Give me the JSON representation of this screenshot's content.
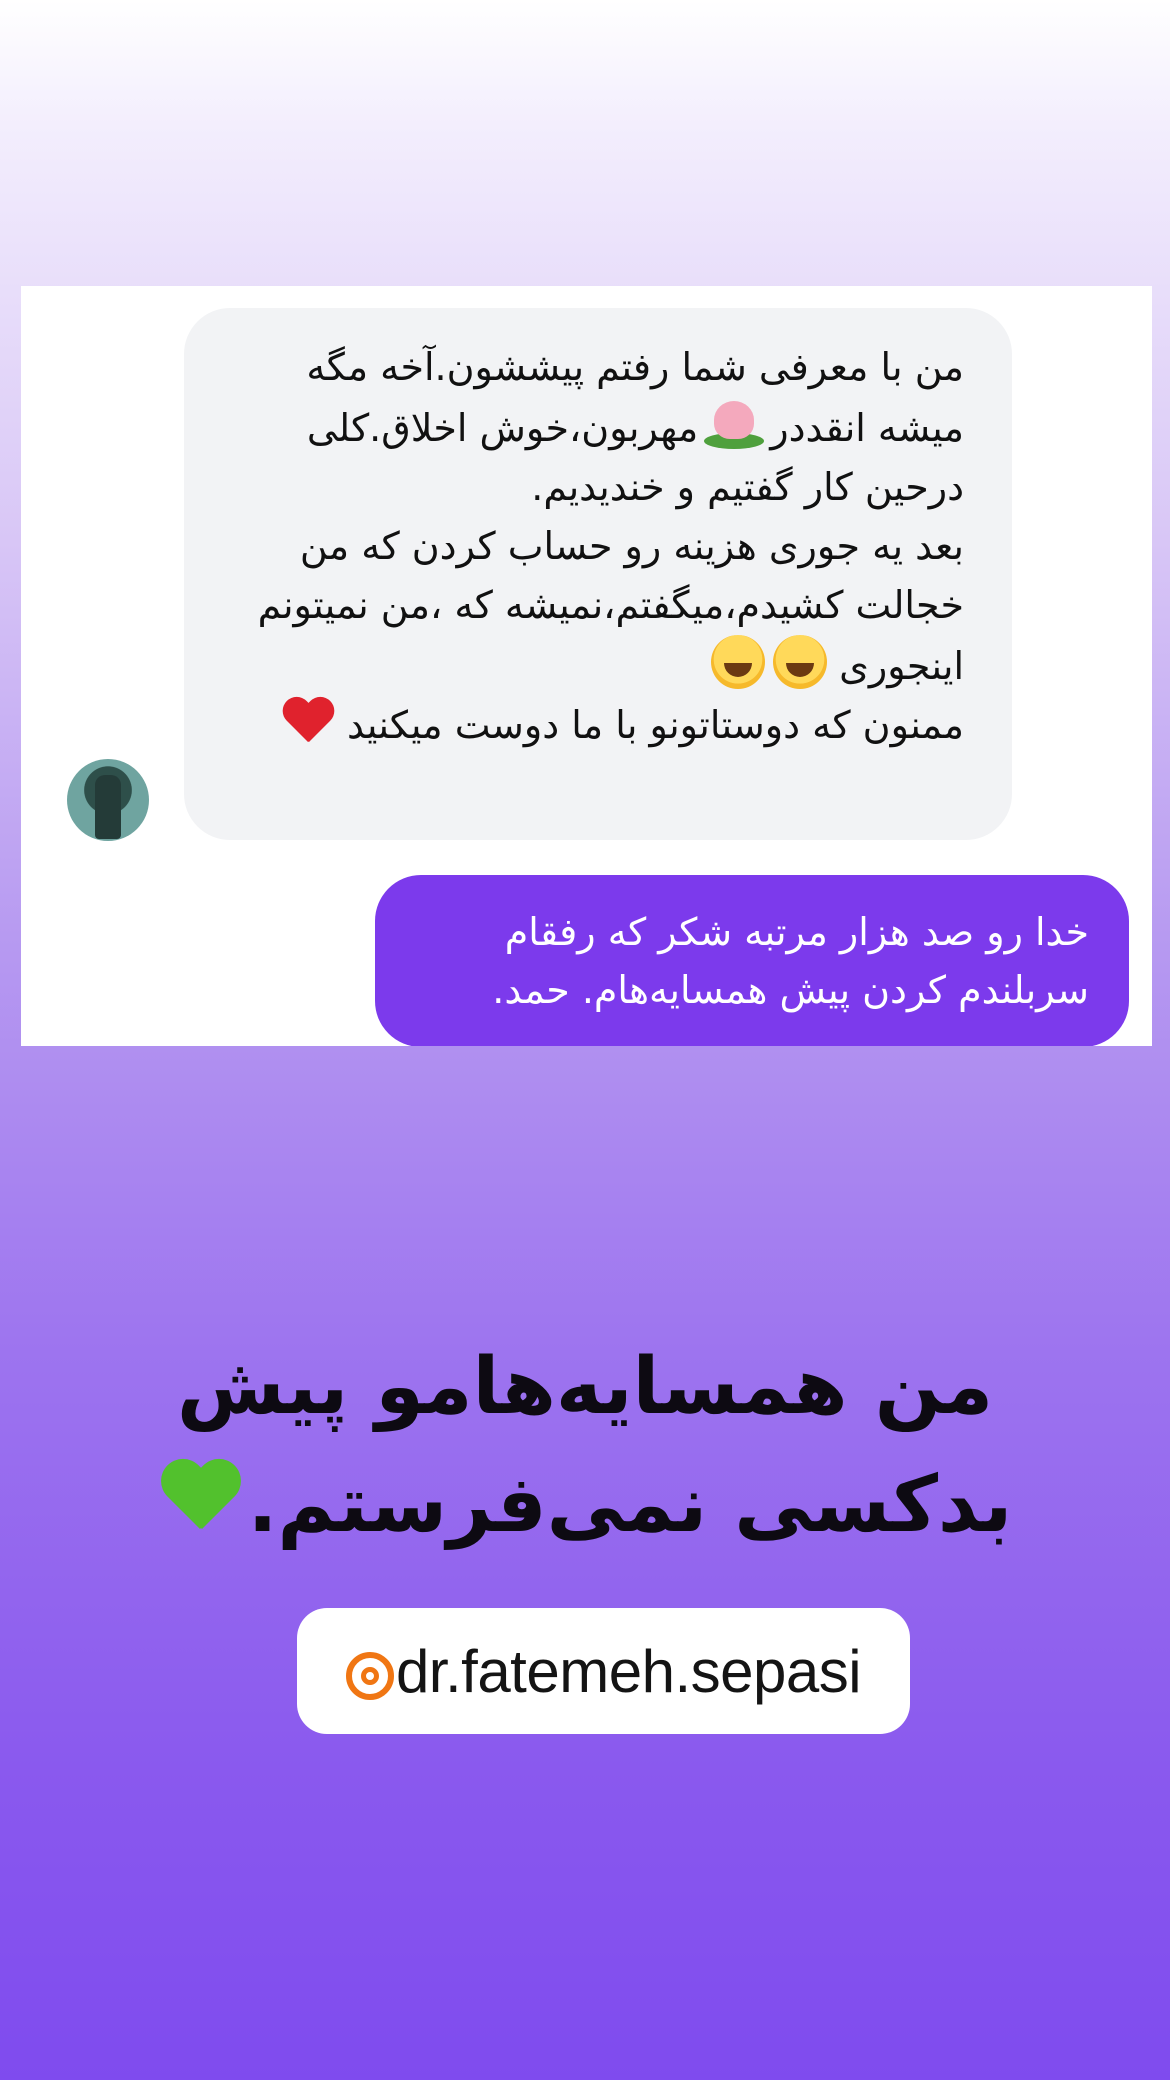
{
  "chat": {
    "incoming": {
      "line1": "من با معرفی شما رفتم پیششون.آخه مگه میشه انقددر",
      "line1_after": "مهربون،خوش اخلاق.کلی درحین کار گفتیم و خندیدیم.",
      "line2": "بعد یه جوری هزینه رو حساب کردن که من خجالت کشیدم،میگفتم،نمیشه که ،من نمیتونم اینجوری",
      "line3": "ممنون که دوستاتونو با ما دوست میکنید",
      "emojis": [
        "lotus-emoji",
        "laughing-emoji",
        "laughing-emoji",
        "red-heart-emoji"
      ]
    },
    "outgoing": {
      "text": "خدا رو صد هزار مرتبه شکر که رفقام سربلندم کردن پیش همسایه‌هام. حمد."
    },
    "colors": {
      "incoming_bubble": "#f2f3f5",
      "outgoing_bubble": "#7c3aec"
    }
  },
  "headline": {
    "text": "من همسایه‌هامو پیش بدکسی نمی‌فرستم.",
    "emoji": "green-heart-emoji"
  },
  "handle": {
    "icon": "threads-icon",
    "text": "dr.fatemeh.sepasi",
    "icon_color": "#f07613"
  }
}
